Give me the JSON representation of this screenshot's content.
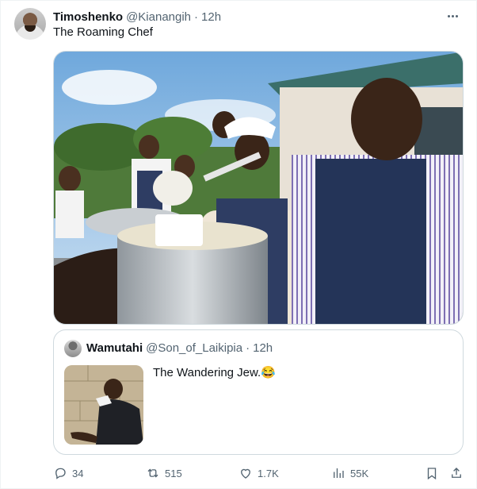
{
  "tweet": {
    "author_name": "Timoshenko",
    "author_handle": "@Kianangih",
    "separator": "·",
    "time": "12h",
    "text": "The Roaming Chef",
    "more_icon": "more-horizontal-icon"
  },
  "quoted": {
    "author_name": "Wamutahi",
    "author_handle": "@Son_of_Laikipia",
    "separator": "·",
    "time": "12h",
    "text": "The Wandering Jew.😂"
  },
  "actions": {
    "replies": "34",
    "retweets": "515",
    "likes": "1.7K",
    "views": "55K"
  },
  "colors": {
    "secondary_text": "#536471",
    "border": "#cfd9de"
  }
}
